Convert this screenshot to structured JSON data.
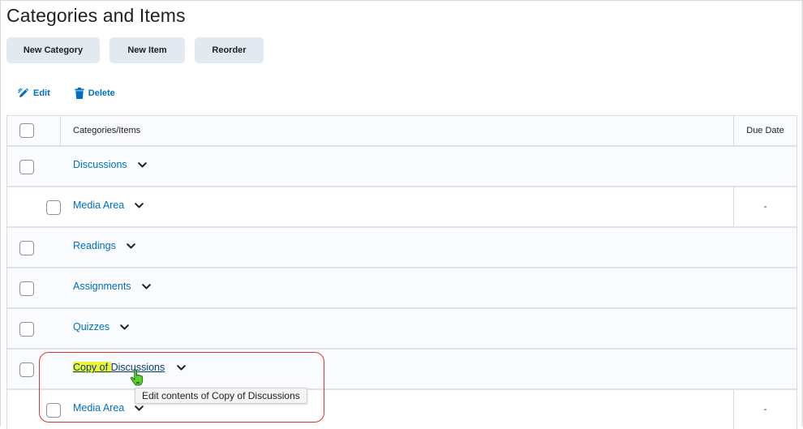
{
  "page": {
    "title": "Categories and Items"
  },
  "toolbar": {
    "new_category_label": "New Category",
    "new_item_label": "New Item",
    "reorder_label": "Reorder"
  },
  "actions": {
    "edit_label": "Edit",
    "delete_label": "Delete",
    "edit_icon": "pencil-icon",
    "delete_icon": "trash-icon"
  },
  "table": {
    "columns": {
      "name": "Categories/Items",
      "due_date": "Due Date"
    },
    "rows": [
      {
        "type": "category",
        "name": "Discussions",
        "checked": false
      },
      {
        "type": "item",
        "name": "Media Area",
        "due_date": "-",
        "checked": false
      },
      {
        "type": "category",
        "name": "Readings",
        "checked": false
      },
      {
        "type": "category",
        "name": "Assignments",
        "checked": false
      },
      {
        "type": "category",
        "name": "Quizzes",
        "checked": false
      },
      {
        "type": "category",
        "name": "Copy of Discussions",
        "name_part_highlighted": "Copy of ",
        "name_part_rest": "Discussions",
        "checked": false,
        "hovered": true
      },
      {
        "type": "item",
        "name": "Media Area",
        "due_date": "-",
        "checked": false
      }
    ]
  },
  "tooltip": {
    "text": "Edit contents of Copy of Discussions"
  },
  "colors": {
    "link": "#006fbf",
    "button_bg": "#e3e9f1",
    "highlight": "#eef33c",
    "callout_border": "#e0352f",
    "cursor": "#5bd12f"
  }
}
